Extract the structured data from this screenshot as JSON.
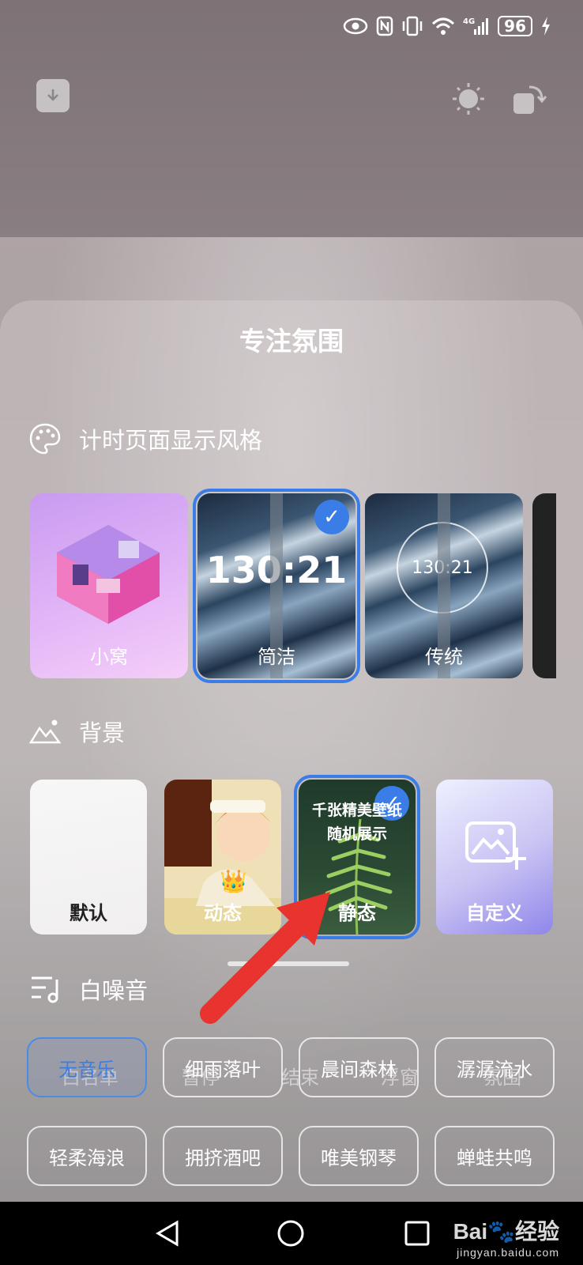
{
  "status_bar": {
    "battery": "96",
    "icons": [
      "eye-icon",
      "nfc-icon",
      "vibrate-icon",
      "wifi-icon",
      "4g-signal-icon",
      "battery-icon",
      "charging-icon"
    ]
  },
  "top_bar": {
    "left_icon": "download-icon",
    "right_icons": [
      "brightness-icon",
      "rotate-icon"
    ]
  },
  "sheet": {
    "title": "专注氛围"
  },
  "timer_style": {
    "header": "计时页面显示风格",
    "options": [
      {
        "label": "小窝",
        "selected": false
      },
      {
        "label": "简洁",
        "selected": true,
        "time": "130:21"
      },
      {
        "label": "传统",
        "selected": false,
        "time": "130:21"
      }
    ]
  },
  "background": {
    "header": "背景",
    "options": [
      {
        "label": "默认",
        "selected": false
      },
      {
        "label": "动态",
        "selected": false
      },
      {
        "label": "静态",
        "selected": true,
        "desc_line1": "千张精美壁纸",
        "desc_line2": "随机展示"
      },
      {
        "label": "自定义",
        "selected": false
      }
    ]
  },
  "white_noise": {
    "header": "白噪音",
    "chips": [
      {
        "label": "无音乐",
        "active": true
      },
      {
        "label": "细雨落叶",
        "active": false
      },
      {
        "label": "晨间森林",
        "active": false
      },
      {
        "label": "潺潺流水",
        "active": false
      },
      {
        "label": "轻柔海浪",
        "active": false
      },
      {
        "label": "拥挤酒吧",
        "active": false
      },
      {
        "label": "唯美钢琴",
        "active": false
      },
      {
        "label": "蝉蛙共鸣",
        "active": false
      }
    ]
  },
  "underlying_controls": [
    "白名单",
    "暂停",
    "结束",
    "浮窗",
    "氛围"
  ],
  "nav": {
    "icons": [
      "back-icon",
      "home-icon",
      "recents-icon"
    ]
  },
  "watermark": {
    "main": "Bai🐾经验",
    "sub": "jingyan.baidu.com"
  },
  "colors": {
    "accent": "#3a7de6",
    "annotation_arrow": "#e8332f"
  }
}
